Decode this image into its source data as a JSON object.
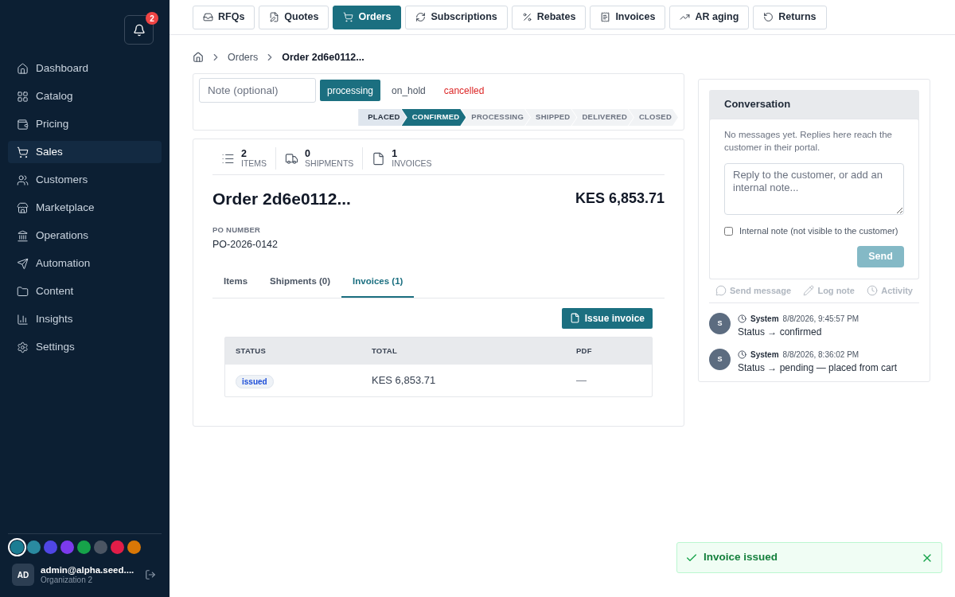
{
  "sidebar": {
    "notifications": {
      "count": "2"
    },
    "items": [
      {
        "label": "Dashboard",
        "selected": false
      },
      {
        "label": "Catalog",
        "selected": false
      },
      {
        "label": "Pricing",
        "selected": false
      },
      {
        "label": "Sales",
        "selected": true
      },
      {
        "label": "Customers",
        "selected": false
      },
      {
        "label": "Marketplace",
        "selected": false
      },
      {
        "label": "Operations",
        "selected": false
      },
      {
        "label": "Automation",
        "selected": false
      },
      {
        "label": "Content",
        "selected": false
      },
      {
        "label": "Insights",
        "selected": false
      },
      {
        "label": "Settings",
        "selected": false
      }
    ],
    "swatches": [
      {
        "color": "#1b7d93",
        "selected": true
      },
      {
        "color": "#2a8aa0",
        "selected": false
      },
      {
        "color": "#4f46e5",
        "selected": false
      },
      {
        "color": "#7c3aed",
        "selected": false
      },
      {
        "color": "#16a34a",
        "selected": false
      },
      {
        "color": "#4b5563",
        "selected": false
      },
      {
        "color": "#e11d48",
        "selected": false
      },
      {
        "color": "#d97706",
        "selected": false
      }
    ],
    "user": {
      "initials": "AD",
      "email": "admin@alpha.seed....",
      "org": "Organization 2"
    }
  },
  "top_tabs": [
    {
      "label": "RFQs",
      "selected": false
    },
    {
      "label": "Quotes",
      "selected": false
    },
    {
      "label": "Orders",
      "selected": true
    },
    {
      "label": "Subscriptions",
      "selected": false
    },
    {
      "label": "Rebates",
      "selected": false
    },
    {
      "label": "Invoices",
      "selected": false
    },
    {
      "label": "AR aging",
      "selected": false
    },
    {
      "label": "Returns",
      "selected": false
    }
  ],
  "breadcrumb": [
    "Orders",
    "Order 2d6e0112..."
  ],
  "status_panel": {
    "note_placeholder": "Note (optional)",
    "actions": [
      {
        "label": "processing",
        "kind": "primary"
      },
      {
        "label": "on_hold",
        "kind": "plain"
      },
      {
        "label": "cancelled",
        "kind": "danger"
      }
    ],
    "steps": [
      {
        "label": "PLACED",
        "done": true,
        "selected": false
      },
      {
        "label": "CONFIRMED",
        "done": false,
        "selected": true
      },
      {
        "label": "PROCESSING",
        "done": false,
        "selected": false
      },
      {
        "label": "SHIPPED",
        "done": false,
        "selected": false
      },
      {
        "label": "DELIVERED",
        "done": false,
        "selected": false
      },
      {
        "label": "CLOSED",
        "done": false,
        "selected": false
      }
    ]
  },
  "order": {
    "stats": [
      {
        "value": "2",
        "label": "ITEMS"
      },
      {
        "value": "0",
        "label": "SHIPMENTS"
      },
      {
        "value": "1",
        "label": "INVOICES"
      }
    ],
    "title": "Order 2d6e0112...",
    "total": "KES 6,853.71",
    "po_label": "PO NUMBER",
    "po_value": "PO-2026-0142",
    "tabs": [
      {
        "label": "Items",
        "selected": false
      },
      {
        "label": "Shipments (0)",
        "selected": false
      },
      {
        "label": "Invoices (1)",
        "selected": true
      }
    ],
    "issue_button": "Issue invoice",
    "table": {
      "columns": [
        "STATUS",
        "TOTAL",
        "PDF"
      ],
      "rows": [
        {
          "status": "issued",
          "total": "KES 6,853.71",
          "pdf": "—"
        }
      ]
    }
  },
  "conversation": {
    "title": "Conversation",
    "empty_text": "No messages yet. Replies here reach the customer in their portal.",
    "placeholder": "Reply to the customer, or add an internal note...",
    "internal_note": {
      "label": "Internal note (not visible to the customer)",
      "checked": false
    },
    "send": "Send",
    "modes": [
      "Send message",
      "Log note",
      "Activity"
    ],
    "events": [
      {
        "avatar": "S",
        "author": "System",
        "time": "8/8/2026, 9:45:57 PM",
        "text": "Status → confirmed"
      },
      {
        "avatar": "S",
        "author": "System",
        "time": "8/8/2026, 8:36:02 PM",
        "text": "Status → pending — placed from cart"
      }
    ]
  },
  "toast": {
    "text": "Invoice issued"
  }
}
